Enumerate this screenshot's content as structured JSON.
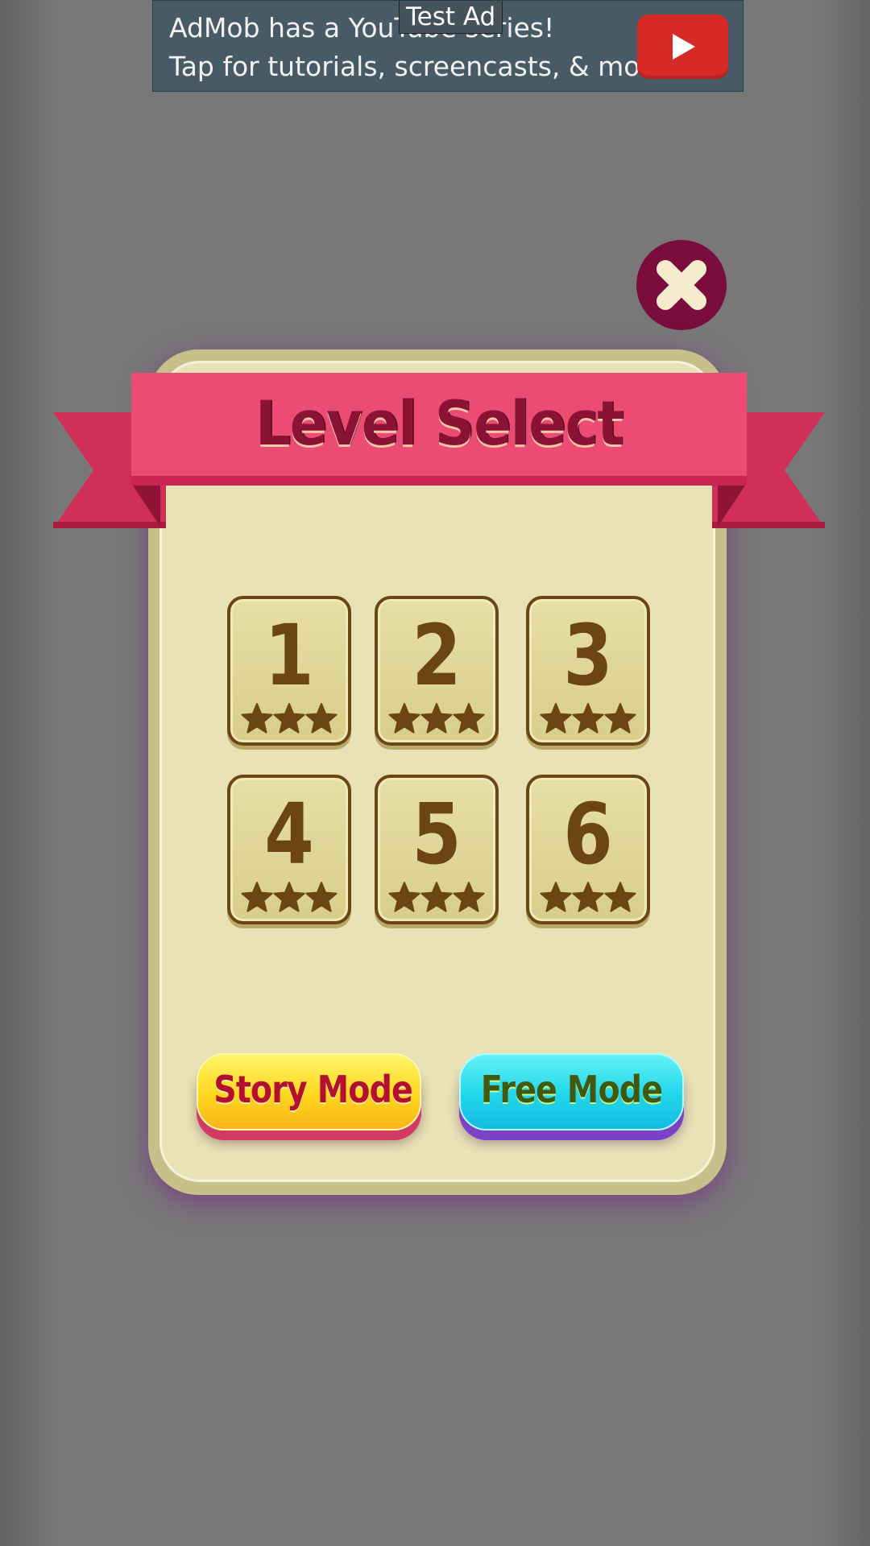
{
  "ad": {
    "tag": "Test Ad",
    "line1": "AdMob has a YouTube series!",
    "line2": "Tap for tutorials, screencasts, & more.",
    "play_icon": "youtube-play-icon"
  },
  "dialog": {
    "title": "Level Select",
    "close_icon": "close-x-icon"
  },
  "levels": [
    {
      "number": "1",
      "stars": 3
    },
    {
      "number": "2",
      "stars": 3
    },
    {
      "number": "3",
      "stars": 3
    },
    {
      "number": "4",
      "stars": 3
    },
    {
      "number": "5",
      "stars": 3
    },
    {
      "number": "6",
      "stars": 3
    }
  ],
  "modes": {
    "story_label": "Story Mode",
    "free_label": "Free Mode"
  },
  "colors": {
    "ribbon": "#ec4c73",
    "ribbon_text": "#8a1234",
    "panel": "#e8e2b6",
    "tile_text": "#6b4612",
    "close_button": "#7a0c3e",
    "story_button": "#ffd61e",
    "free_button": "#20d6ea"
  }
}
